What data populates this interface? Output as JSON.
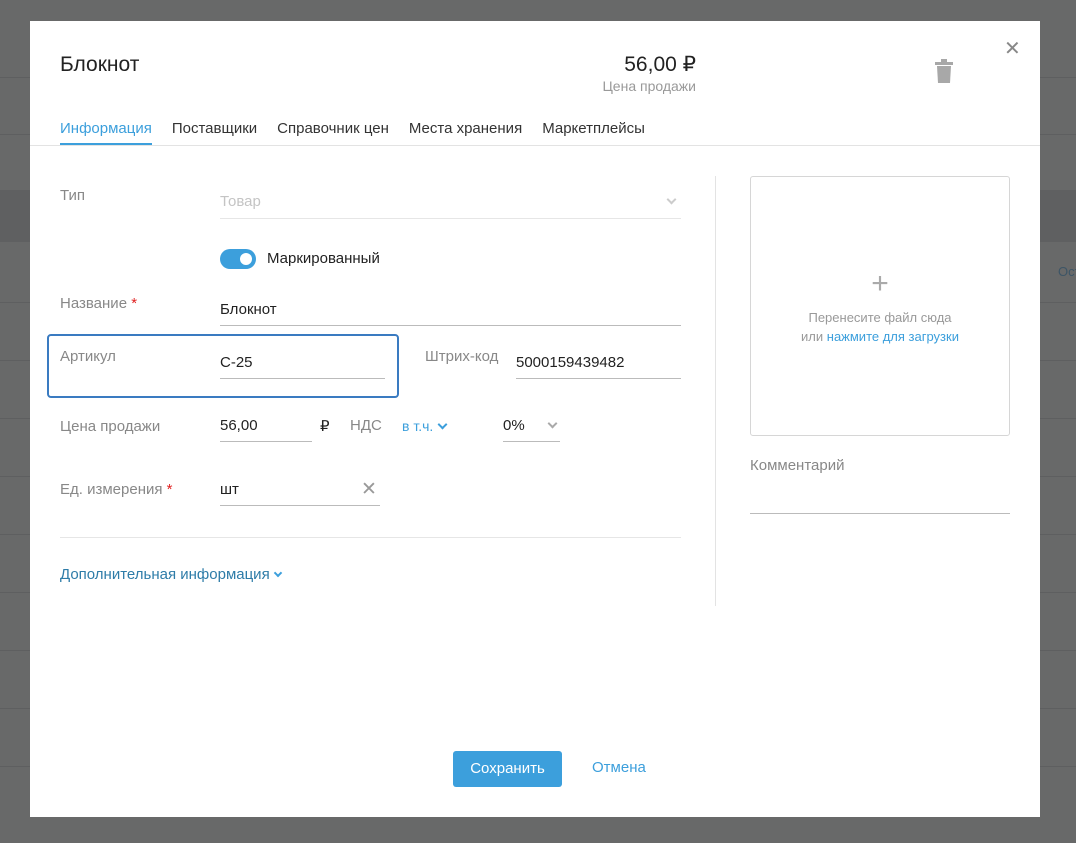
{
  "background": {
    "text": "Ост"
  },
  "header": {
    "title": "Блокнот",
    "price": "56,00 ₽",
    "price_label": "Цена продажи"
  },
  "tabs": [
    {
      "label": "Информация",
      "active": true
    },
    {
      "label": "Поставщики"
    },
    {
      "label": "Справочник цен"
    },
    {
      "label": "Места хранения"
    },
    {
      "label": "Маркетплейсы"
    }
  ],
  "form": {
    "type_label": "Тип",
    "type_value": "Товар",
    "marked_label": "Маркированный",
    "marked_on": true,
    "name_label": "Название",
    "name_value": "Блокнот",
    "article_label": "Артикул",
    "article_value": "С-25",
    "barcode_label": "Штрих-код",
    "barcode_value": "5000159439482",
    "price_label": "Цена продажи",
    "price_value": "56,00",
    "currency": "₽",
    "vat_label": "НДС",
    "vat_mode": "в т.ч.",
    "vat_rate": "0%",
    "unit_label": "Ед. измерения",
    "unit_value": "шт",
    "required_mark": "*",
    "more_info": "Дополнительная информация"
  },
  "upload": {
    "plus": "+",
    "text": "Перенесите файл сюда",
    "or": "или ",
    "link": "нажмите для загрузки"
  },
  "comment_label": "Комментарий",
  "footer": {
    "save": "Сохранить",
    "cancel": "Отмена"
  },
  "colors": {
    "accent": "#3c9fdc",
    "focus": "#3a7bc1",
    "required": "#e02020"
  }
}
